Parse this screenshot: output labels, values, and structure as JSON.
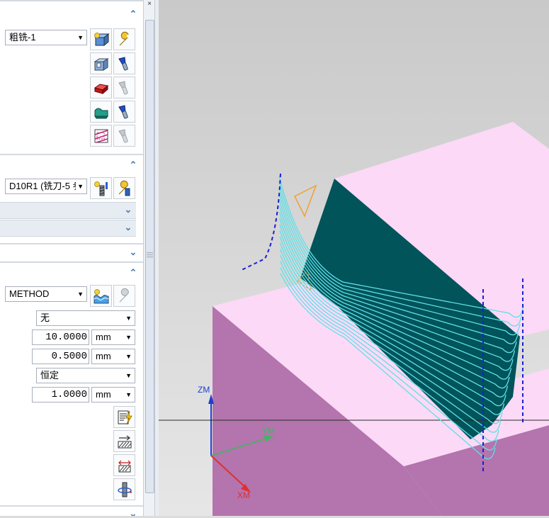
{
  "geometry": {
    "program_value": "粗铣-1",
    "tool_value": "D10R1 (铣刀-5 参"
  },
  "method": {
    "method_value": "METHOD",
    "option1_value": "无",
    "value1": "10.0000",
    "unit1": "mm",
    "value2": "0.5000",
    "unit2": "mm",
    "option2_value": "恒定",
    "value3": "1.0000",
    "unit3": "mm"
  },
  "viewport": {
    "axis_z": "ZM",
    "axis_y": "YM",
    "axis_x": "XM",
    "colors": {
      "background_top": "#c9c9c9",
      "background_bottom": "#e6e6e6",
      "block_top": "#fcd9f6",
      "block_side": "#b474ad",
      "wall": "#00545a",
      "toolpath": "#5fe0e8",
      "axis_z": "#1d3fd0",
      "axis_y": "#3cb860",
      "axis_x": "#e03030"
    }
  }
}
